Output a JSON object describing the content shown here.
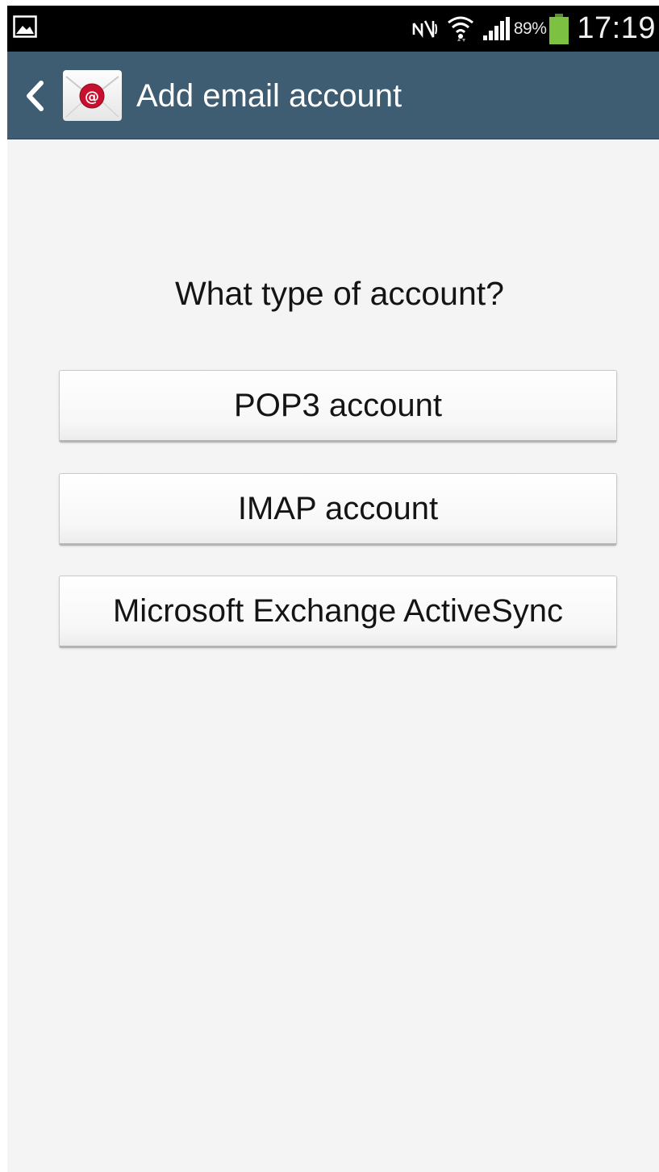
{
  "status_bar": {
    "battery_percent": "89%",
    "time": "17:19",
    "icons": [
      "gallery-icon",
      "nfc-icon",
      "wifi-icon",
      "signal-icon",
      "battery-icon"
    ]
  },
  "action_bar": {
    "title": "Add email account",
    "icons": [
      "back-arrow-icon",
      "email-app-icon"
    ]
  },
  "content": {
    "question": "What type of account?",
    "options": [
      {
        "label": "POP3 account"
      },
      {
        "label": "IMAP account"
      },
      {
        "label": "Microsoft Exchange ActiveSync"
      }
    ]
  },
  "colors": {
    "action_bar": "#3e5c72",
    "background": "#f4f4f4",
    "battery": "#7dc142",
    "email_badge": "#c8102e"
  }
}
